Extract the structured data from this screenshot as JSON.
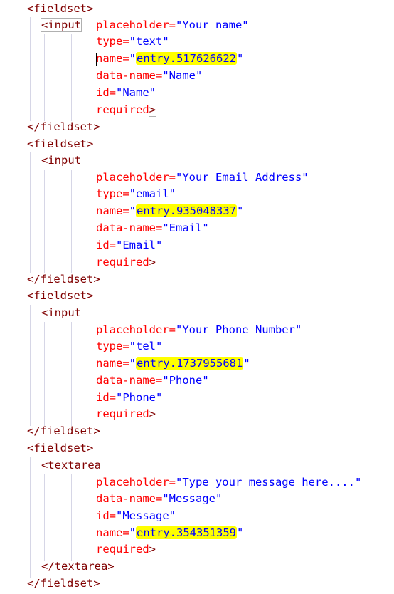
{
  "code": {
    "fieldset_open": "<fieldset>",
    "fieldset_close": "</fieldset>",
    "input_open": "<input",
    "textarea_open": "<textarea",
    "textarea_close": "</textarea>",
    "name_field": {
      "placeholder_attr": "placeholder=",
      "placeholder_val": "\"Your name\"",
      "type_attr": "type=",
      "type_val": "\"text\"",
      "name_attr": "name=",
      "name_val": "entry.517626622",
      "dataname_attr": "data-name=",
      "dataname_val": "\"Name\"",
      "id_attr": "id=",
      "id_val": "\"Name\"",
      "required": "required"
    },
    "email_field": {
      "placeholder_attr": "placeholder=",
      "placeholder_val": "\"Your Email Address\"",
      "type_attr": "type=",
      "type_val": "\"email\"",
      "name_attr": "name=",
      "name_val": "entry.935048337",
      "dataname_attr": "data-name=",
      "dataname_val": "\"Email\"",
      "id_attr": "id=",
      "id_val": "\"Email\"",
      "required": "required"
    },
    "phone_field": {
      "placeholder_attr": "placeholder=",
      "placeholder_val": "\"Your Phone Number\"",
      "type_attr": "type=",
      "type_val": "\"tel\"",
      "name_attr": "name=",
      "name_val": "entry.1737955681",
      "dataname_attr": "data-name=",
      "dataname_val": "\"Phone\"",
      "id_attr": "id=",
      "id_val": "\"Phone\"",
      "required": "required"
    },
    "message_field": {
      "placeholder_attr": "placeholder=",
      "placeholder_val": "\"Type your message here....\"",
      "dataname_attr": "data-name=",
      "dataname_val": "\"Message\"",
      "id_attr": "id=",
      "id_val": "\"Message\"",
      "name_attr": "name=",
      "name_val": "entry.354351359",
      "required": "required"
    },
    "quote": "\"",
    "close_angle": ">",
    "highlight_color": "#ffff00"
  }
}
